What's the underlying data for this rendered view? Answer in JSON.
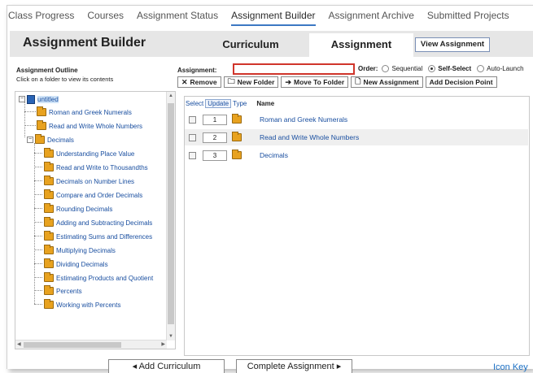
{
  "nav": {
    "items": [
      {
        "label": "Class Progress",
        "active": false
      },
      {
        "label": "Courses",
        "active": false
      },
      {
        "label": "Assignment Status",
        "active": false
      },
      {
        "label": "Assignment Builder",
        "active": true
      },
      {
        "label": "Assignment Archive",
        "active": false
      },
      {
        "label": "Submitted Projects",
        "active": false
      }
    ]
  },
  "header": {
    "title": "Assignment Builder",
    "tabs": [
      {
        "label": "Curriculum",
        "active": false
      },
      {
        "label": "Assignment",
        "active": true
      }
    ],
    "view_button": "View Assignment"
  },
  "outline": {
    "title": "Assignment Outline",
    "hint": "Click on a folder to view its contents",
    "root": "untitled",
    "items": [
      {
        "label": "Roman and Greek Numerals",
        "level": 1
      },
      {
        "label": "Read and Write Whole Numbers",
        "level": 1
      },
      {
        "label": "Decimals",
        "level": 1,
        "expanded": true
      },
      {
        "label": "Understanding Place Value",
        "level": 2
      },
      {
        "label": "Read and Write to Thousandths",
        "level": 2
      },
      {
        "label": "Decimals on Number Lines",
        "level": 2
      },
      {
        "label": "Compare and Order Decimals",
        "level": 2
      },
      {
        "label": "Rounding Decimals",
        "level": 2
      },
      {
        "label": "Adding and Subtracting Decimals",
        "level": 2
      },
      {
        "label": "Estimating Sums and Differences",
        "level": 2
      },
      {
        "label": "Multiplying Decimals",
        "level": 2
      },
      {
        "label": "Dividing Decimals",
        "level": 2
      },
      {
        "label": "Estimating Products and Quotient",
        "level": 2
      },
      {
        "label": "Percents",
        "level": 2
      },
      {
        "label": "Working with Percents",
        "level": 2
      }
    ]
  },
  "form": {
    "assignment_label": "Assignment:",
    "assignment_value": "",
    "order_label": "Order:",
    "order_options": [
      {
        "label": "Sequential",
        "selected": false
      },
      {
        "label": "Self-Select",
        "selected": true
      },
      {
        "label": "Auto-Launch",
        "selected": false
      }
    ]
  },
  "toolbar": {
    "remove": "Remove",
    "new_folder": "New Folder",
    "move_to_folder": "Move To Folder",
    "new_assignment": "New Assignment",
    "add_decision_point": "Add Decision Point"
  },
  "grid": {
    "header": {
      "select": "Select",
      "update": "Update",
      "type": "Type",
      "name": "Name"
    },
    "rows": [
      {
        "order": "1",
        "name": "Roman and Greek Numerals"
      },
      {
        "order": "2",
        "name": "Read and Write Whole Numbers"
      },
      {
        "order": "3",
        "name": "Decimals"
      }
    ]
  },
  "footer": {
    "add_curriculum": "◂ Add Curriculum",
    "complete_assignment": "Complete Assignment ▸",
    "icon_key": "Icon Key"
  },
  "colors": {
    "accent": "#3c78c3",
    "link": "#1a4fa0",
    "error_border": "#d0352b",
    "folder": "#e8a21f"
  }
}
